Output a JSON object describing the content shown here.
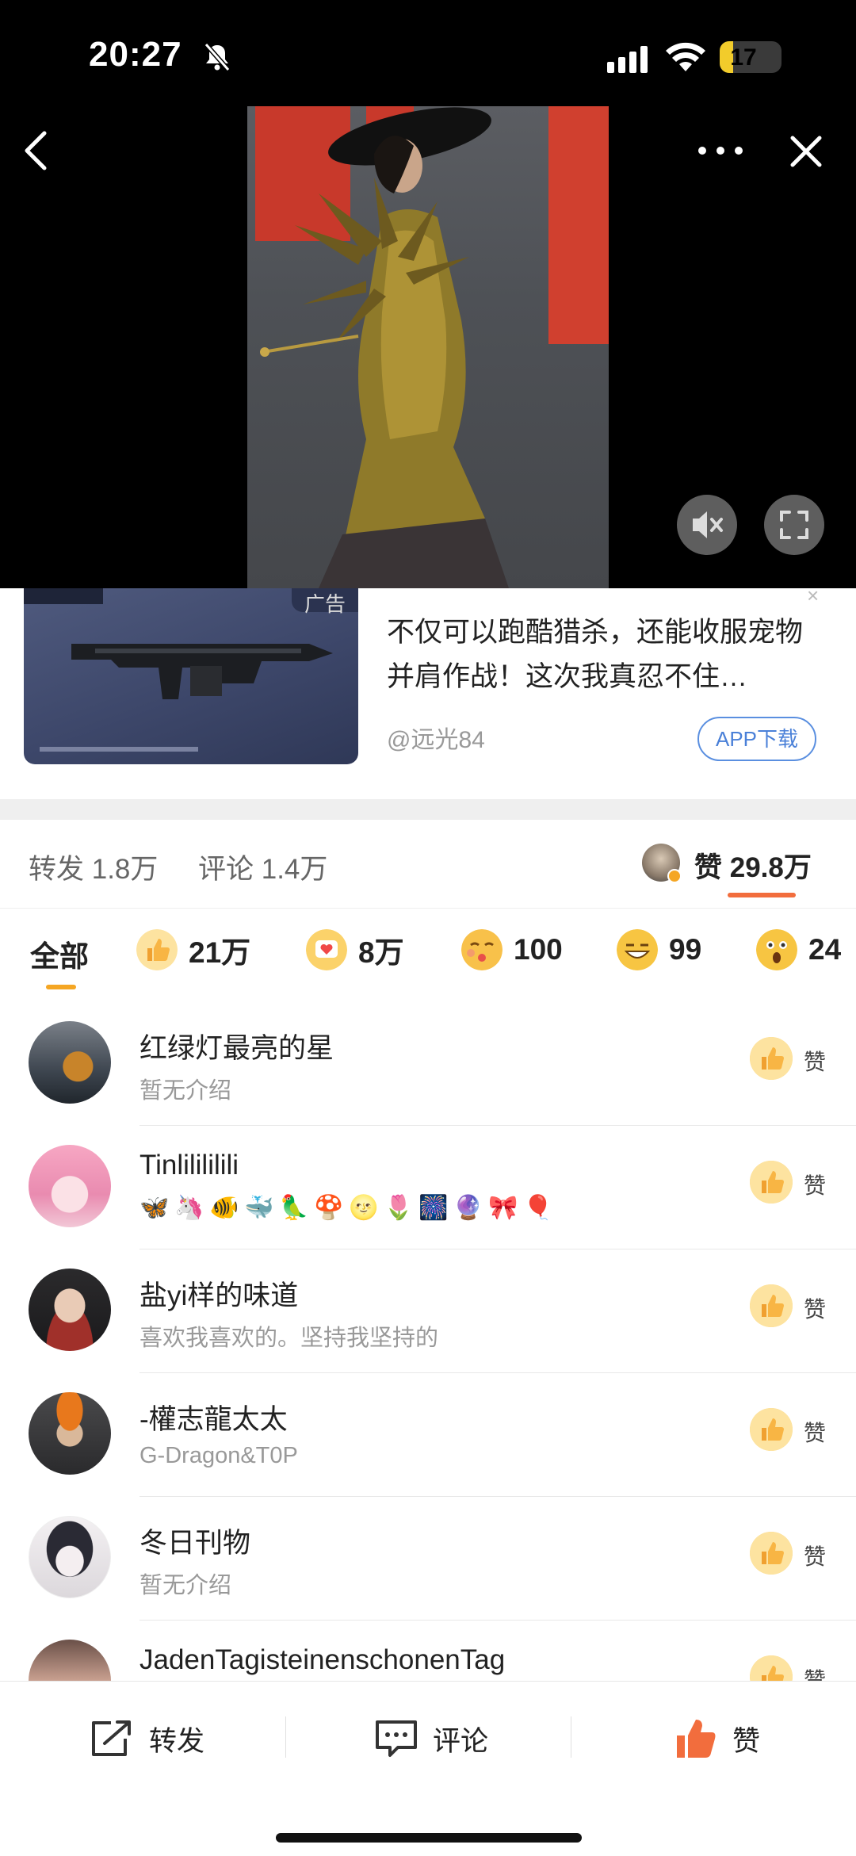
{
  "status_bar": {
    "time": "20:27",
    "battery_percent": "17",
    "battery_level": 0.17,
    "icons": [
      "bell-muted-icon",
      "cellular-signal-icon",
      "wifi-icon",
      "battery-icon"
    ]
  },
  "video": {
    "nav": {
      "back": "chevron-left-icon",
      "more": "more-dots-icon",
      "close": "close-icon"
    },
    "controls": {
      "mute": "speaker-muted-icon",
      "fullscreen": "fullscreen-icon"
    }
  },
  "ad": {
    "tag": "广告",
    "title": "不仅可以跑酷猎杀，还能收服宠物并肩作战！这次我真忍不住…",
    "source": "@远光84",
    "download_label": "APP下载",
    "close_glyph": "×"
  },
  "stats": {
    "repost": "转发 1.8万",
    "comment": "评论 1.4万",
    "like": "赞 29.8万"
  },
  "reaction_tabs": {
    "all_label": "全部",
    "items": [
      {
        "emoji": "thumbs-up-icon",
        "count": "21万",
        "color": "#f8b544"
      },
      {
        "emoji": "heart-message-icon",
        "count": "8万",
        "color": "#f5a623"
      },
      {
        "emoji": "kiss-face-icon",
        "count": "100",
        "color": "#f8c14a"
      },
      {
        "emoji": "grin-face-icon",
        "count": "99",
        "color": "#f7c542"
      },
      {
        "emoji": "surprised-face-icon",
        "count": "24",
        "color": "#f7c542"
      }
    ]
  },
  "users": [
    {
      "name": "红绿灯最亮的星",
      "desc": "暂无介绍",
      "like_label": "赞"
    },
    {
      "name": "Tinlilililili",
      "desc": "",
      "emojis": [
        "🦋",
        "🦄",
        "🐠",
        "🐳",
        "🦜",
        "🍄",
        "🌝",
        "🌷",
        "🎆",
        "🔮",
        "🎀",
        "🎈"
      ],
      "like_label": "赞"
    },
    {
      "name": "盐yi样的味道",
      "desc": "喜欢我喜欢的。坚持我坚持的",
      "like_label": "赞"
    },
    {
      "name": "-權志龍太太",
      "desc": "G-Dragon&T0P",
      "like_label": "赞"
    },
    {
      "name": "冬日刊物",
      "desc": "暂无介绍",
      "like_label": "赞"
    },
    {
      "name": "JadenTagisteinenschonenTag",
      "desc": "",
      "like_label": "赞"
    }
  ],
  "bottom_bar": {
    "repost_label": "转发",
    "comment_label": "评论",
    "like_label": "赞"
  },
  "colors": {
    "accent_orange": "#f26d3d",
    "like_yellow": "#fdd87a",
    "link_blue": "#4a80d8"
  }
}
